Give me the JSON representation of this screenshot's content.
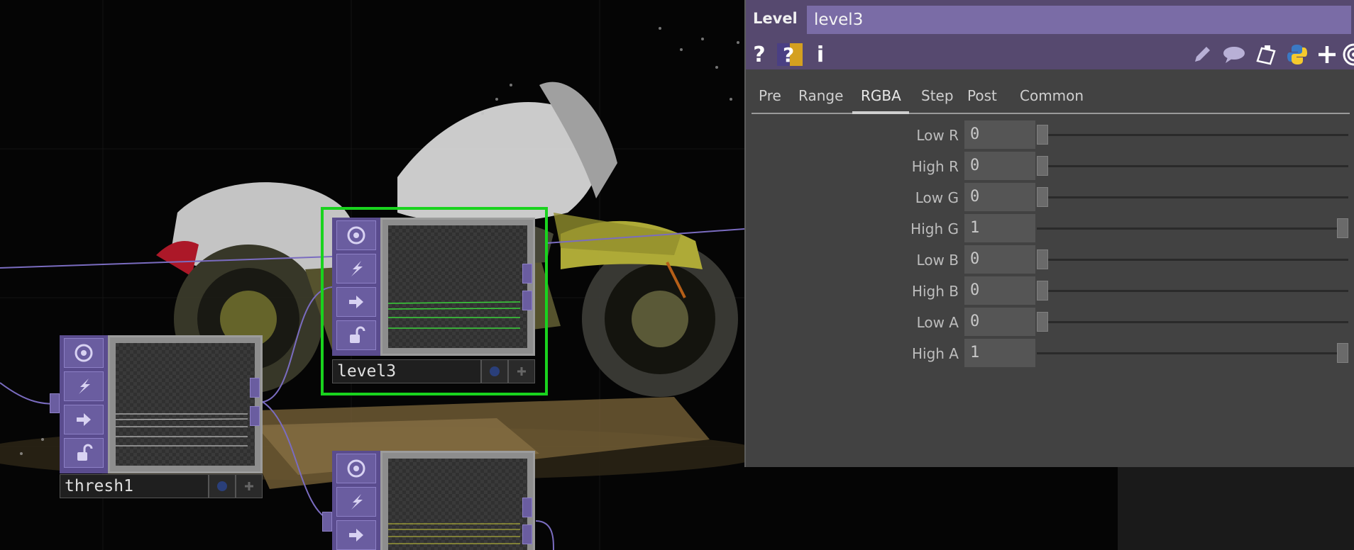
{
  "panel": {
    "op_type": "Level",
    "op_name": "level3",
    "tabs": [
      {
        "label": "Pre"
      },
      {
        "label": "Range"
      },
      {
        "label": "RGBA",
        "active": true
      },
      {
        "label": "Step"
      },
      {
        "label": "Post"
      },
      {
        "label": "Common"
      }
    ],
    "params": [
      {
        "label": "Low R",
        "value": "0",
        "slider_level": 0
      },
      {
        "label": "High R",
        "value": "0",
        "slider_level": 0
      },
      {
        "label": "Low G",
        "value": "0",
        "slider_level": 0
      },
      {
        "label": "High G",
        "value": "1",
        "slider_level": 1
      },
      {
        "label": "Low B",
        "value": "0",
        "slider_level": 0
      },
      {
        "label": "High B",
        "value": "0",
        "slider_level": 0
      },
      {
        "label": "Low A",
        "value": "0",
        "slider_level": 0
      },
      {
        "label": "High A",
        "value": "1",
        "slider_level": 1
      }
    ],
    "toolbar_icons": [
      "help-icon",
      "compare-help-icon",
      "info-icon",
      "pencil-icon",
      "comment-icon",
      "clipboard-icon",
      "python-icon",
      "plus-icon",
      "target-icon"
    ],
    "help_glyph": "?",
    "info_glyph": "i"
  },
  "nodes": [
    {
      "name": "level3",
      "selected": true
    },
    {
      "name": "thresh1",
      "selected": false
    },
    {
      "name": "",
      "selected": false
    }
  ],
  "colors": {
    "selection": "#19d31e",
    "node_purple": "#5a4c8e",
    "wire": "#7a6cc0",
    "titlebar": "#56496f"
  }
}
